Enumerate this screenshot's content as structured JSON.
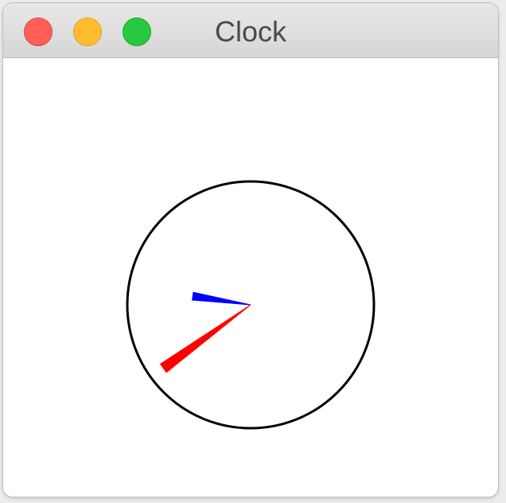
{
  "window": {
    "title": "Clock"
  },
  "clock": {
    "hour_hand": {
      "hours": 9,
      "minutes": 17,
      "color": "#0000ff"
    },
    "minute_hand": {
      "minutes": 39,
      "color": "#ff0000"
    },
    "face_color": "#000000"
  },
  "colors": {
    "close": "#ff5f57",
    "minimize": "#febc2e",
    "zoom": "#28c840"
  }
}
